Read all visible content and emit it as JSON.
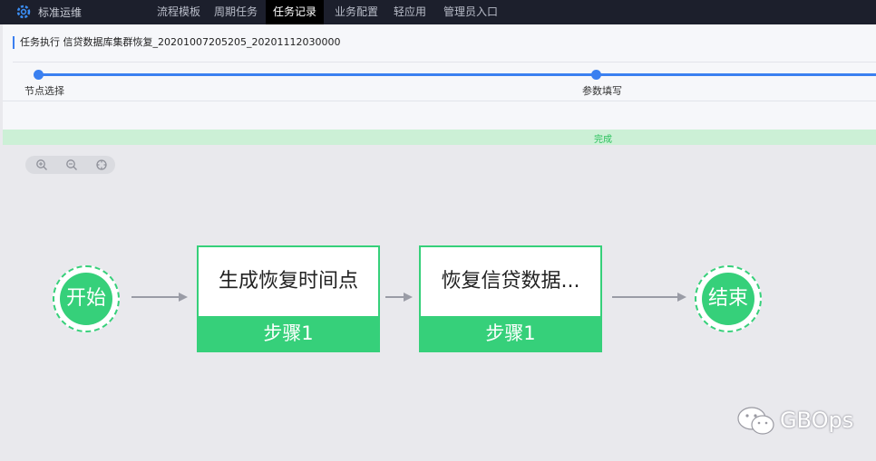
{
  "app": {
    "brand": "标准运维"
  },
  "nav": [
    "流程模板",
    "周期任务",
    "任务记录",
    "业务配置",
    "轻应用",
    "管理员入口"
  ],
  "nav_active": "任务记录",
  "page": {
    "title": "任务执行 信贷数据库集群恢复_20201007205205_20201112030000"
  },
  "steps": [
    "节点选择",
    "参数填写"
  ],
  "status": "完成",
  "zoom": {
    "icons": [
      "zoom-in-icon",
      "zoom-out-icon",
      "reset-icon"
    ]
  },
  "flow": {
    "start": "开始",
    "end": "结束",
    "nodes": [
      {
        "title": "生成恢复时间点",
        "step": "步骤1"
      },
      {
        "title": "恢复信贷数据...",
        "step": "步骤1"
      }
    ]
  },
  "watermark": "GBOps",
  "colors": {
    "accent": "#3a80f0",
    "node": "#36d07a",
    "topbar": "#1c1f2c"
  }
}
